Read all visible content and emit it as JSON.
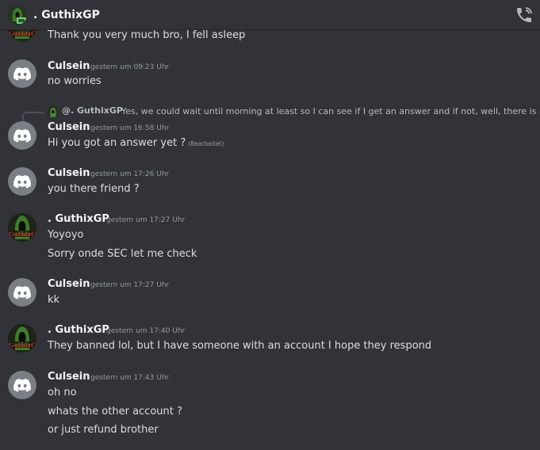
{
  "header": {
    "title": ". GuthixGP",
    "icons": [
      "guthix-avatar",
      "voice-call-icon"
    ]
  },
  "avatar_tag": "GuthixGP",
  "messages": [
    {
      "kind": "continuation",
      "lines": [
        "Thank you very much bro, I fell asleep"
      ]
    },
    {
      "kind": "message",
      "author": "Culsein",
      "timestamp": "gestern um 09:23 Uhr",
      "lines": [
        "no worries"
      ]
    },
    {
      "kind": "reply",
      "author": "Culsein",
      "timestamp": "gestern um 16:58 Uhr",
      "reply_to": {
        "author": "@. GuthixGP",
        "text": "Yes, we could wait until morning at least so I can see if I get an answer and if not, well, there is no o..."
      },
      "lines": [
        "Hi you got an answer yet ?"
      ],
      "edited_label": "(Bearbeitet)"
    },
    {
      "kind": "message",
      "author": "Culsein",
      "timestamp": "gestern um 17:26 Uhr",
      "lines": [
        "you there friend ?"
      ]
    },
    {
      "kind": "message",
      "author": ". GuthixGP",
      "timestamp": "gestern um 17:27 Uhr",
      "lines": [
        "Yoyoyo",
        "Sorry onde SEC let me check"
      ]
    },
    {
      "kind": "message",
      "author": "Culsein",
      "timestamp": "gestern um 17:27 Uhr",
      "lines": [
        "kk"
      ]
    },
    {
      "kind": "message",
      "author": ". GuthixGP",
      "timestamp": "gestern um 17:40 Uhr",
      "lines": [
        "They banned lol, but I have someone with an account I hope they respond"
      ]
    },
    {
      "kind": "message",
      "author": "Culsein",
      "timestamp": "gestern um 17:43 Uhr",
      "lines": [
        "oh no",
        "whats the other account ?",
        "or just refund brother"
      ]
    }
  ],
  "colors": {
    "background": "#313338",
    "text": "#dbdee1",
    "muted": "#949ba4",
    "discord_avatar": "#7a7e85",
    "guthix_green": "#4caf50"
  }
}
